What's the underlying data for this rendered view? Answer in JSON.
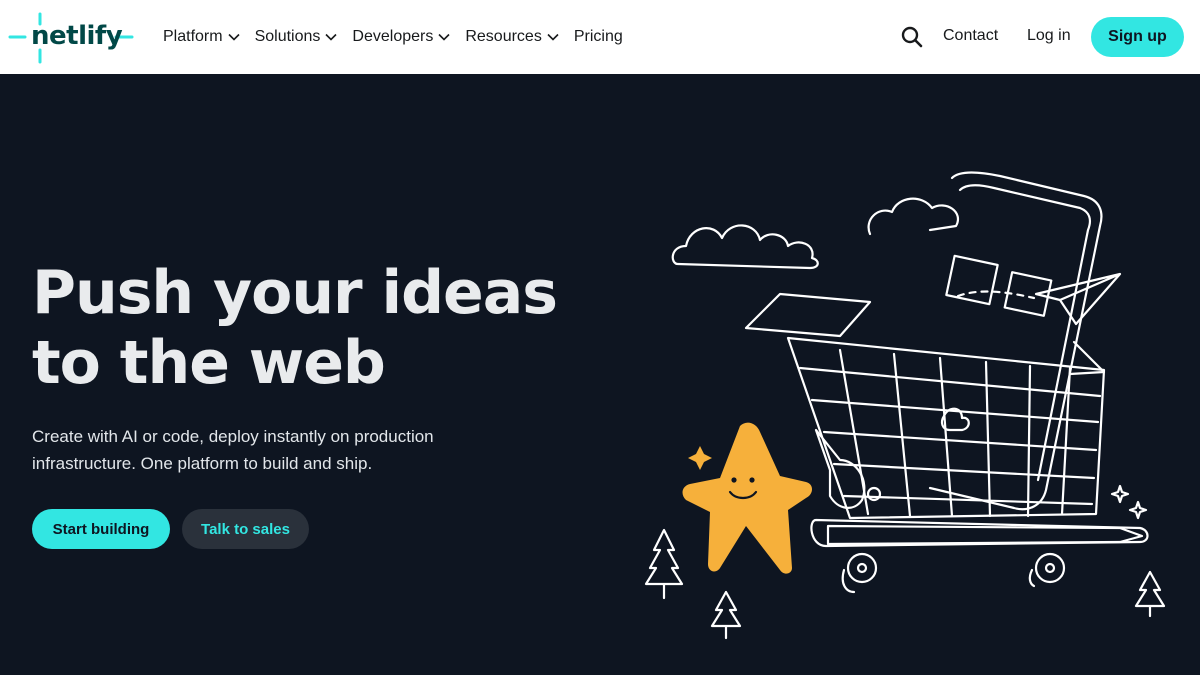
{
  "header": {
    "logo_text": "netlify",
    "nav": [
      {
        "label": "Platform",
        "has_dropdown": true
      },
      {
        "label": "Solutions",
        "has_dropdown": true
      },
      {
        "label": "Developers",
        "has_dropdown": true
      },
      {
        "label": "Resources",
        "has_dropdown": true
      },
      {
        "label": "Pricing",
        "has_dropdown": false
      }
    ],
    "search_icon": "search-icon",
    "contact_label": "Contact",
    "login_label": "Log in",
    "signup_label": "Sign up"
  },
  "hero": {
    "title_line1": "Push your ideas",
    "title_line2": "to the web",
    "subtitle_line1": "Create with AI or code, deploy instantly on production",
    "subtitle_line2": "infrastructure. One platform to build and ship.",
    "primary_cta": "Start building",
    "secondary_cta": "Talk to sales"
  },
  "colors": {
    "brand_teal": "#32e6e2",
    "logo_dark": "#014847",
    "background": "#0e1521",
    "header_bg": "#ffffff",
    "mascot_yellow": "#f6b03b"
  }
}
